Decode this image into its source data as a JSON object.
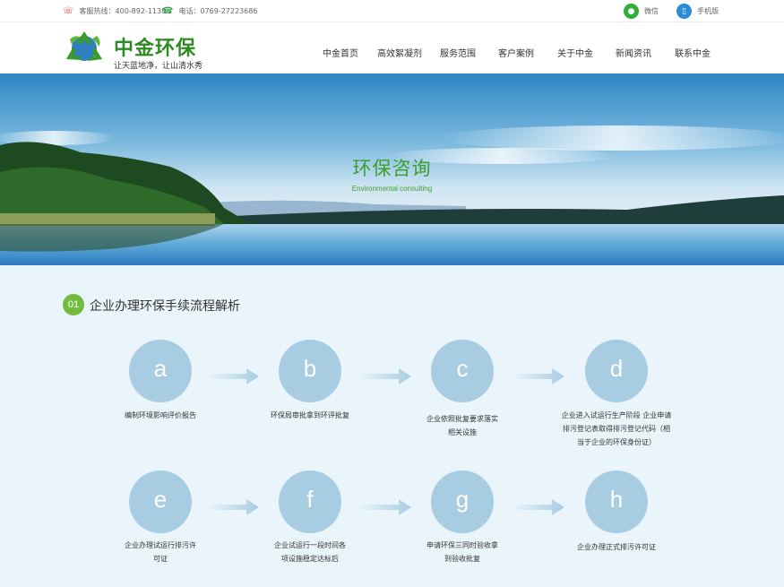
{
  "topbar": {
    "hotline": "客服热线：400-892-1138",
    "phone": "电话：0769-27223686",
    "wechat": "微信",
    "mobile": "手机版"
  },
  "brand": {
    "name": "中金环保",
    "slogan": "让天蓝地净，让山清水秀"
  },
  "nav": [
    "中金首页",
    "高效絮凝剂",
    "服务范围",
    "客户案例",
    "关于中金",
    "新闻资讯",
    "联系中金"
  ],
  "banner": {
    "title": "环保咨询",
    "subtitle": "Environmental consulting"
  },
  "section": {
    "number": "01",
    "title": "企业办理环保手续流程解析"
  },
  "steps": [
    {
      "letter": "a",
      "lines": [
        "编制环境影响评价报告"
      ]
    },
    {
      "letter": "b",
      "lines": [
        "环保局审批拿到环评批复"
      ]
    },
    {
      "letter": "c",
      "lines": [
        "企业依照批复要求落实",
        "相关设施"
      ]
    },
    {
      "letter": "d",
      "lines": [
        "企业进入试运行生产阶段 企业申请",
        "排污登记表取得排污登记代码（相",
        "当于企业的环保身份证）"
      ]
    },
    {
      "letter": "e",
      "lines": [
        "企业办理试运行排污许",
        "可证"
      ]
    },
    {
      "letter": "f",
      "lines": [
        "企业试运行一段时间各",
        "项设施稳定达标后"
      ]
    },
    {
      "letter": "g",
      "lines": [
        "申请环保三同时验收拿",
        "到验收批复"
      ]
    },
    {
      "letter": "h",
      "lines": [
        "企业办理正式排污许可证"
      ]
    }
  ],
  "colors": {
    "brand_green": "#2e8b22",
    "accent_green": "#72bb3e",
    "step_circle": "#a8cde2",
    "content_bg": "#e9f4fb"
  }
}
